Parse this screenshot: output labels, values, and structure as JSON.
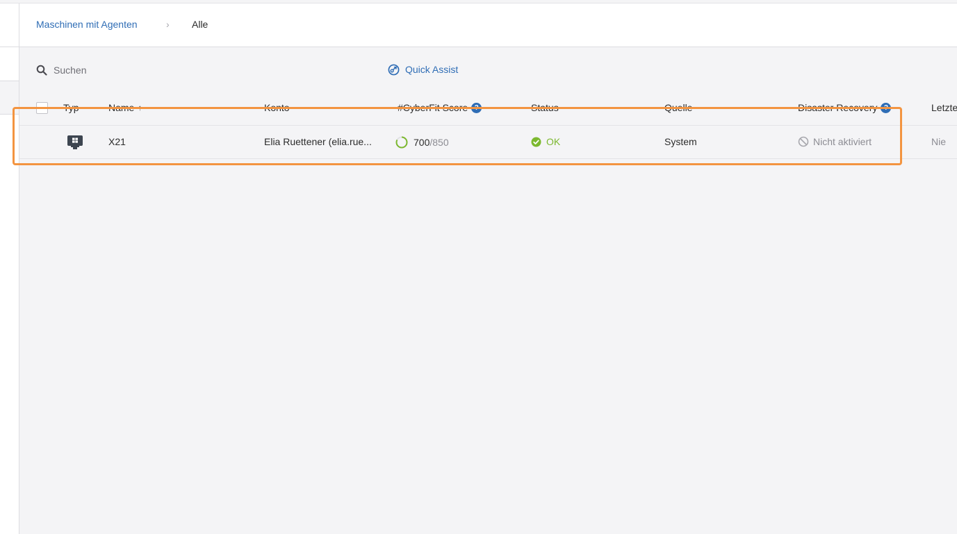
{
  "breadcrumb": {
    "parent": "Maschinen mit Agenten",
    "separator": "›",
    "current": "Alle"
  },
  "toolbar": {
    "search_placeholder": "Suchen",
    "quick_assist": "Quick Assist"
  },
  "table": {
    "columns": {
      "typ": "Typ",
      "name": "Name",
      "name_sort": "↑",
      "konto": "Konto",
      "cyberfit": "#CyberFit Score",
      "status": "Status",
      "quelle": "Quelle",
      "disaster_recovery": "Disaster Recovery",
      "letzte": "Letzte",
      "info_glyph": "?"
    },
    "rows": [
      {
        "typ_icon": "windows-workstation-icon",
        "name": "X21",
        "konto": "Elia Ruettener (elia.rue...",
        "score": "700",
        "score_max": "/850",
        "status": "OK",
        "quelle": "System",
        "disaster_recovery": "Nicht aktiviert",
        "letzte": "Nie"
      }
    ]
  },
  "colors": {
    "accent": "#2f6db5",
    "ok": "#7cb82f",
    "highlight": "#f39440"
  }
}
